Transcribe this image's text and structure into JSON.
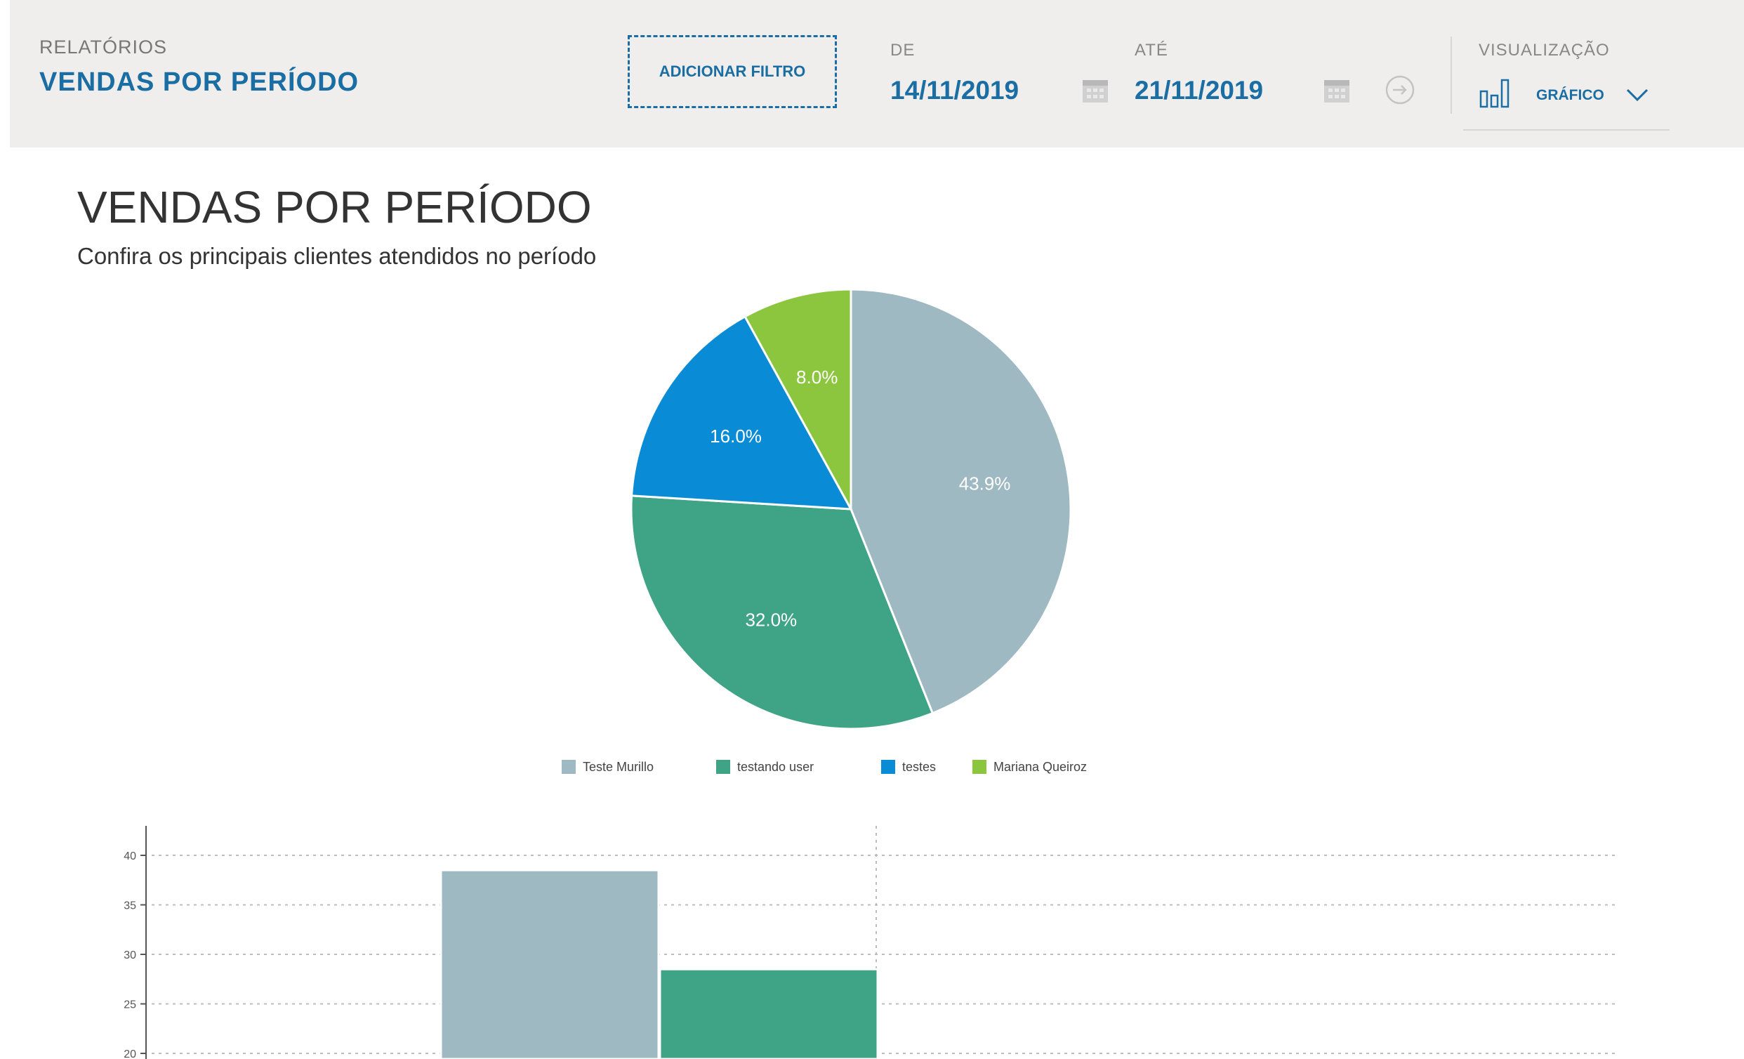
{
  "header": {
    "breadcrumb": "RELATÓRIOS",
    "title": "VENDAS POR PERÍODO",
    "add_filter_label": "ADICIONAR FILTRO",
    "from_label": "DE",
    "from_value": "14/11/2019",
    "to_label": "ATÉ",
    "to_value": "21/11/2019",
    "view_label": "VISUALIZAÇÃO",
    "view_value": "GRÁFICO"
  },
  "content": {
    "title": "VENDAS POR PERÍODO",
    "subtitle": "Confira os principais clientes atendidos no período"
  },
  "colors": {
    "accent": "#1a6ea3",
    "teste_murillo": "#9fb9c3",
    "testando_user": "#3fa385",
    "testes": "#0a8bd6",
    "mariana_queiroz": "#8cc63f"
  },
  "chart_data": [
    {
      "type": "pie",
      "labels": [
        "Teste Murillo",
        "testando user",
        "testes",
        "Mariana Queiroz"
      ],
      "values": [
        43.9,
        32.0,
        16.0,
        8.0
      ],
      "value_labels": [
        "43.9%",
        "32.0%",
        "16.0%",
        "8.0%"
      ],
      "colors": [
        "#9fb9c3",
        "#3fa385",
        "#0a8bd6",
        "#8cc63f"
      ],
      "legend_position": "bottom"
    },
    {
      "type": "bar",
      "categories": [
        "Teste Murillo",
        "testando user"
      ],
      "values": [
        38.5,
        28.5
      ],
      "colors": [
        "#9fb9c3",
        "#3fa385"
      ],
      "yticks": [
        "40",
        "35",
        "30",
        "25",
        "20"
      ],
      "ylim": [
        20,
        42
      ],
      "grid": true
    }
  ]
}
